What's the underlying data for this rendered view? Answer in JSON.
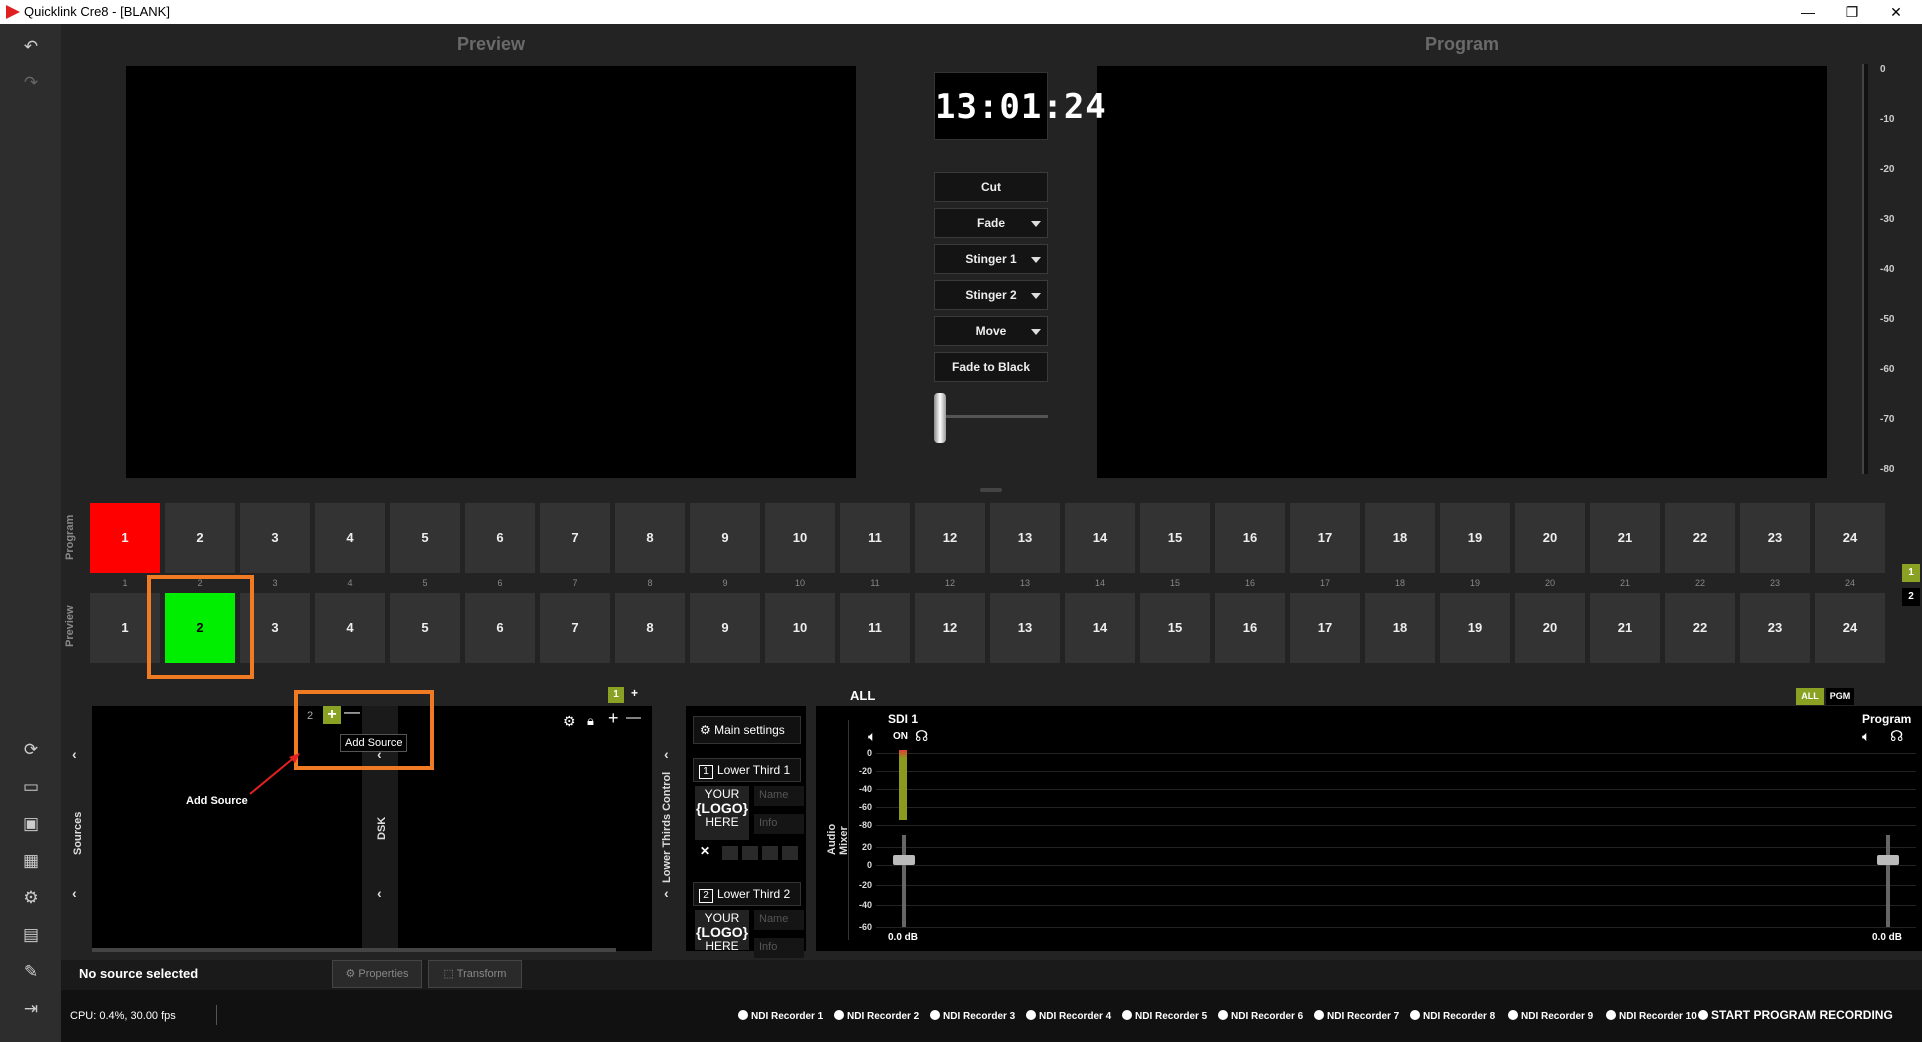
{
  "window": {
    "title": "Quicklink Cre8 - [BLANK]",
    "minimize": "—",
    "maximize": "❐",
    "close": "✕"
  },
  "preview_title": "Preview",
  "program_title": "Program",
  "clock": "13:01:24",
  "transitions": [
    {
      "label": "Cut",
      "dropdown": false
    },
    {
      "label": "Fade",
      "dropdown": true
    },
    {
      "label": "Stinger 1",
      "dropdown": true
    },
    {
      "label": "Stinger 2",
      "dropdown": true
    },
    {
      "label": "Move",
      "dropdown": true
    },
    {
      "label": "Fade to Black",
      "dropdown": false
    }
  ],
  "vu_scale": [
    "0",
    "-10",
    "-20",
    "-30",
    "-40",
    "-50",
    "-60",
    "-70",
    "-80"
  ],
  "program_bus": {
    "label": "Program",
    "buttons": [
      "1",
      "2",
      "3",
      "4",
      "5",
      "6",
      "7",
      "8",
      "9",
      "10",
      "11",
      "12",
      "13",
      "14",
      "15",
      "16",
      "17",
      "18",
      "19",
      "20",
      "21",
      "22",
      "23",
      "24"
    ],
    "active": "1"
  },
  "bus_numbers": [
    "1",
    "2",
    "3",
    "4",
    "5",
    "6",
    "7",
    "8",
    "9",
    "10",
    "11",
    "12",
    "13",
    "14",
    "15",
    "16",
    "17",
    "18",
    "19",
    "20",
    "21",
    "22",
    "23",
    "24"
  ],
  "preview_bus": {
    "label": "Preview",
    "buttons": [
      "1",
      "2",
      "3",
      "4",
      "5",
      "6",
      "7",
      "8",
      "9",
      "10",
      "11",
      "12",
      "13",
      "14",
      "15",
      "16",
      "17",
      "18",
      "19",
      "20",
      "21",
      "22",
      "23",
      "24"
    ],
    "active": "2"
  },
  "bank_selector": [
    "1",
    "2"
  ],
  "scene_tab": {
    "number": "1",
    "add": "+"
  },
  "sources": {
    "label": "Sources",
    "dsk_label": "DSK",
    "scene_count": "2",
    "tooltip": "Add Source",
    "annotation": "Add Source"
  },
  "lower_thirds": {
    "label": "Lower Thirds Control",
    "main_settings": "Main settings",
    "items": [
      {
        "index": "1",
        "title": "Lower Third 1",
        "logo": [
          "YOUR",
          "{LOGO}",
          "HERE"
        ],
        "name_ph": "Name",
        "info_ph": "Info"
      },
      {
        "index": "2",
        "title": "Lower Third 2",
        "logo": [
          "YOUR",
          "{LOGO}",
          "HERE"
        ],
        "name_ph": "Name",
        "info_ph": "Info"
      }
    ]
  },
  "audio": {
    "label": "Audio Mixer",
    "filter_title": "ALL",
    "filter_all": "ALL",
    "filter_pgm": "PGM",
    "channel": {
      "name": "SDI 1",
      "state": "ON",
      "db": "0.0 dB"
    },
    "program": {
      "name": "Program",
      "db": "0.0 dB"
    },
    "scale": [
      "0",
      "-20",
      "-40",
      "-60",
      "-80",
      "20",
      "0",
      "-20",
      "-40",
      "-60"
    ]
  },
  "status": {
    "selection": "No source selected",
    "properties": "Properties",
    "transform": "Transform"
  },
  "footer": {
    "cpu": "CPU: 0.4%, 30.00 fps",
    "recorders": [
      "NDI Recorder 1",
      "NDI Recorder 2",
      "NDI Recorder 3",
      "NDI Recorder 4",
      "NDI Recorder 5",
      "NDI Recorder 6",
      "NDI Recorder 7",
      "NDI Recorder 8",
      "NDI Recorder 9",
      "NDI Recorder 10"
    ],
    "start_recording": "START PROGRAM RECORDING"
  },
  "colors": {
    "program_active": "#ff0000",
    "preview_active": "#00ee00",
    "highlight": "#f07b22",
    "accent": "#8aa224"
  }
}
